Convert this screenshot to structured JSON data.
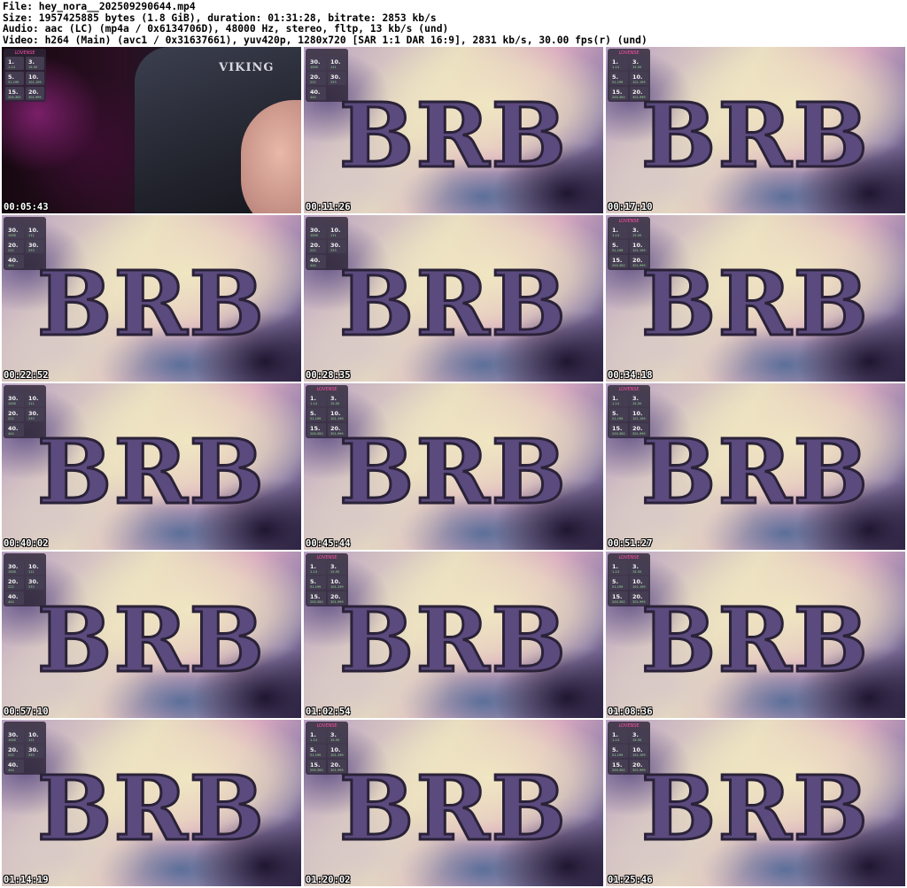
{
  "header": {
    "file": "File: hey_nora__202509290644.mp4",
    "size": "Size: 1957425885 bytes (1.8 GiB), duration: 01:31:28, bitrate: 2853 kb/s",
    "audio": "Audio: aac (LC) (mp4a / 0x6134706D), 48000 Hz, stereo, fltp, 13 kb/s (und)",
    "video": "Video: h264 (Main) (avc1 / 0x31637661), yuv420p, 1280x720 [SAR 1:1 DAR 16:9], 2831 kb/s, 30.00 fps(r) (und)"
  },
  "brb_text": "BRB",
  "chair_text": "VIKING",
  "menu_title": "LOVENSE",
  "menu_sets": {
    "a": [
      {
        "value": "1.",
        "range": "1-14"
      },
      {
        "value": "3.",
        "range": "15-50"
      },
      {
        "value": "5.",
        "range": "51-199"
      },
      {
        "value": "10.",
        "range": "101-199"
      },
      {
        "value": "15.",
        "range": "200-300"
      },
      {
        "value": "20.",
        "range": "301-999"
      }
    ],
    "b": [
      {
        "value": "30.",
        "range": "1000"
      },
      {
        "value": "10.",
        "range": "111"
      },
      {
        "value": "20.",
        "range": "222"
      },
      {
        "value": "30.",
        "range": "333"
      },
      {
        "value": "40.",
        "range": "444"
      }
    ]
  },
  "thumbnails": [
    {
      "time": "00:05:43",
      "scene": "cam",
      "menu": "a"
    },
    {
      "time": "00:11:26",
      "scene": "brb",
      "menu": "b"
    },
    {
      "time": "00:17:10",
      "scene": "brb",
      "menu": "a"
    },
    {
      "time": "00:22:52",
      "scene": "brb",
      "menu": "b"
    },
    {
      "time": "00:28:35",
      "scene": "brb",
      "menu": "b"
    },
    {
      "time": "00:34:18",
      "scene": "brb",
      "menu": "a"
    },
    {
      "time": "00:40:02",
      "scene": "brb",
      "menu": "b"
    },
    {
      "time": "00:45:44",
      "scene": "brb",
      "menu": "a"
    },
    {
      "time": "00:51:27",
      "scene": "brb",
      "menu": "a"
    },
    {
      "time": "00:57:10",
      "scene": "brb",
      "menu": "b"
    },
    {
      "time": "01:02:54",
      "scene": "brb",
      "menu": "a"
    },
    {
      "time": "01:08:36",
      "scene": "brb",
      "menu": "a"
    },
    {
      "time": "01:14:19",
      "scene": "brb",
      "menu": "b"
    },
    {
      "time": "01:20:02",
      "scene": "brb",
      "menu": "a"
    },
    {
      "time": "01:25:46",
      "scene": "brb",
      "menu": "a"
    }
  ]
}
